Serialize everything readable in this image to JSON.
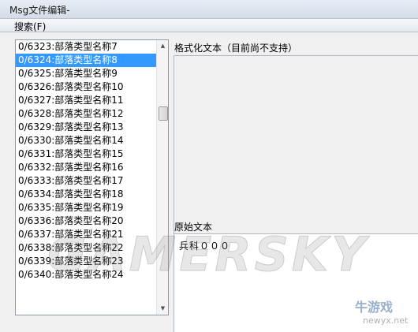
{
  "window": {
    "title": "Msg文件编辑-"
  },
  "menu": {
    "search_label": "搜索(F)"
  },
  "message_list": {
    "items": [
      "0/6323:部落类型名称7",
      "0/6324:部落类型名称8",
      "0/6325:部落类型名称9",
      "0/6326:部落类型名称10",
      "0/6327:部落类型名称11",
      "0/6328:部落类型名称12",
      "0/6329:部落类型名称13",
      "0/6330:部落类型名称14",
      "0/6331:部落类型名称15",
      "0/6332:部落类型名称16",
      "0/6333:部落类型名称17",
      "0/6334:部落类型名称18",
      "0/6335:部落类型名称19",
      "0/6336:部落类型名称20",
      "0/6337:部落类型名称21",
      "0/6338:部落类型名称22",
      "0/6339:部落类型名称23",
      "0/6340:部落类型名称24"
    ],
    "selected_index": 1
  },
  "formatted_text": {
    "label": "格式化文本（目前尚不支持）"
  },
  "original_text": {
    "label": "原始文本",
    "value": "兵科０００"
  },
  "watermark": {
    "text": "GAMERSKY",
    "logo_text": "牛游戏",
    "logo_sub": "newyx.net"
  },
  "colors": {
    "selection": "#3399ff",
    "window_bg": "#f0f0f0"
  }
}
